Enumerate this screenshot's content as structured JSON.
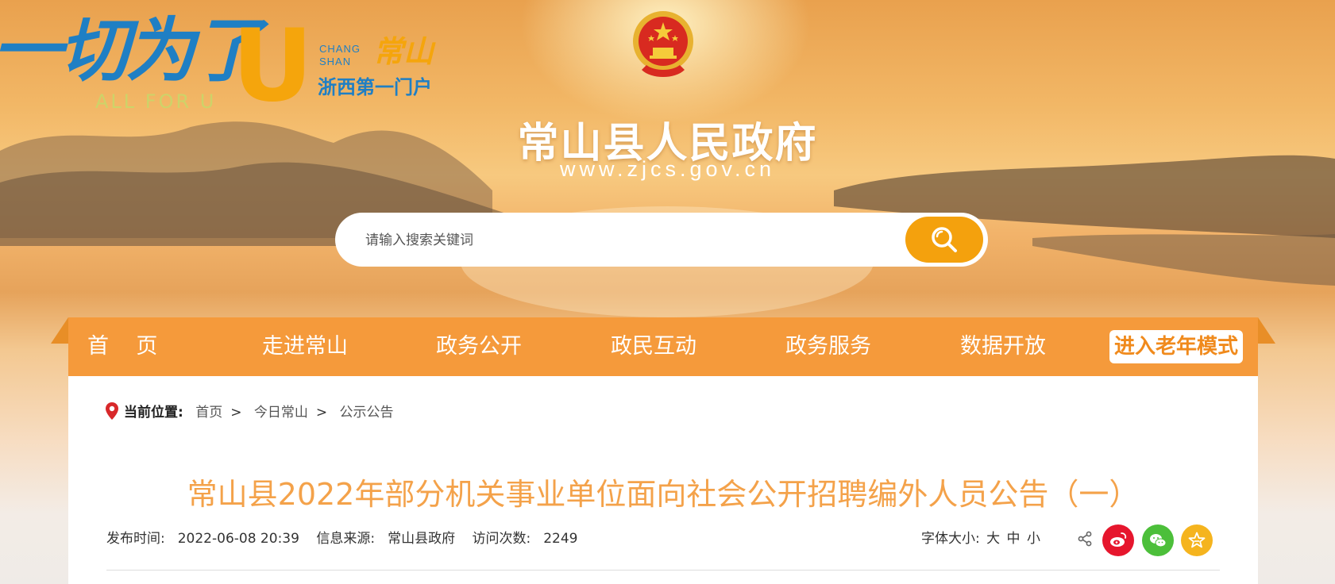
{
  "header": {
    "slogan": "一切为了",
    "slogan_letter": "U",
    "slogan_en": "ALL FOR U",
    "city_en_line1": "CHANG",
    "city_en_line2": "SHAN",
    "city_cn": "常山",
    "tagline": "浙西第一门户",
    "site_title": "常山县人民政府",
    "site_url": "www.zjcs.gov.cn"
  },
  "search": {
    "placeholder": "请输入搜索关键词",
    "icon": "search-icon"
  },
  "nav": {
    "items": [
      {
        "label": "首    页"
      },
      {
        "label": "走进常山"
      },
      {
        "label": "政务公开"
      },
      {
        "label": "政民互动"
      },
      {
        "label": "政务服务"
      },
      {
        "label": "数据开放"
      }
    ],
    "elder_mode": "进入老年模式"
  },
  "breadcrumb": {
    "label": "当前位置:",
    "items": [
      "首页",
      "今日常山",
      "公示公告"
    ],
    "separator": ">"
  },
  "article": {
    "title": "常山县2022年部分机关事业单位面向社会公开招聘编外人员公告（一）",
    "publish_time_label": "发布时间:",
    "publish_time": "2022-06-08 20:39",
    "source_label": "信息来源:",
    "source": "常山县政府",
    "visits_label": "访问次数:",
    "visits": "2249"
  },
  "tools": {
    "font_size_label": "字体大小:",
    "font_sizes": [
      "大",
      "中",
      "小"
    ],
    "share_icons": [
      "share-icon",
      "weibo-icon",
      "wechat-icon",
      "favorite-icon"
    ]
  },
  "colors": {
    "nav_orange": "#f59a3b",
    "accent_orange": "#f4a10d",
    "title_orange": "#f4a24a",
    "logo_blue": "#1f7fc4",
    "weibo_red": "#e6162d",
    "wechat_green": "#4cbf3a",
    "favorite_yellow": "#f5b41e"
  }
}
